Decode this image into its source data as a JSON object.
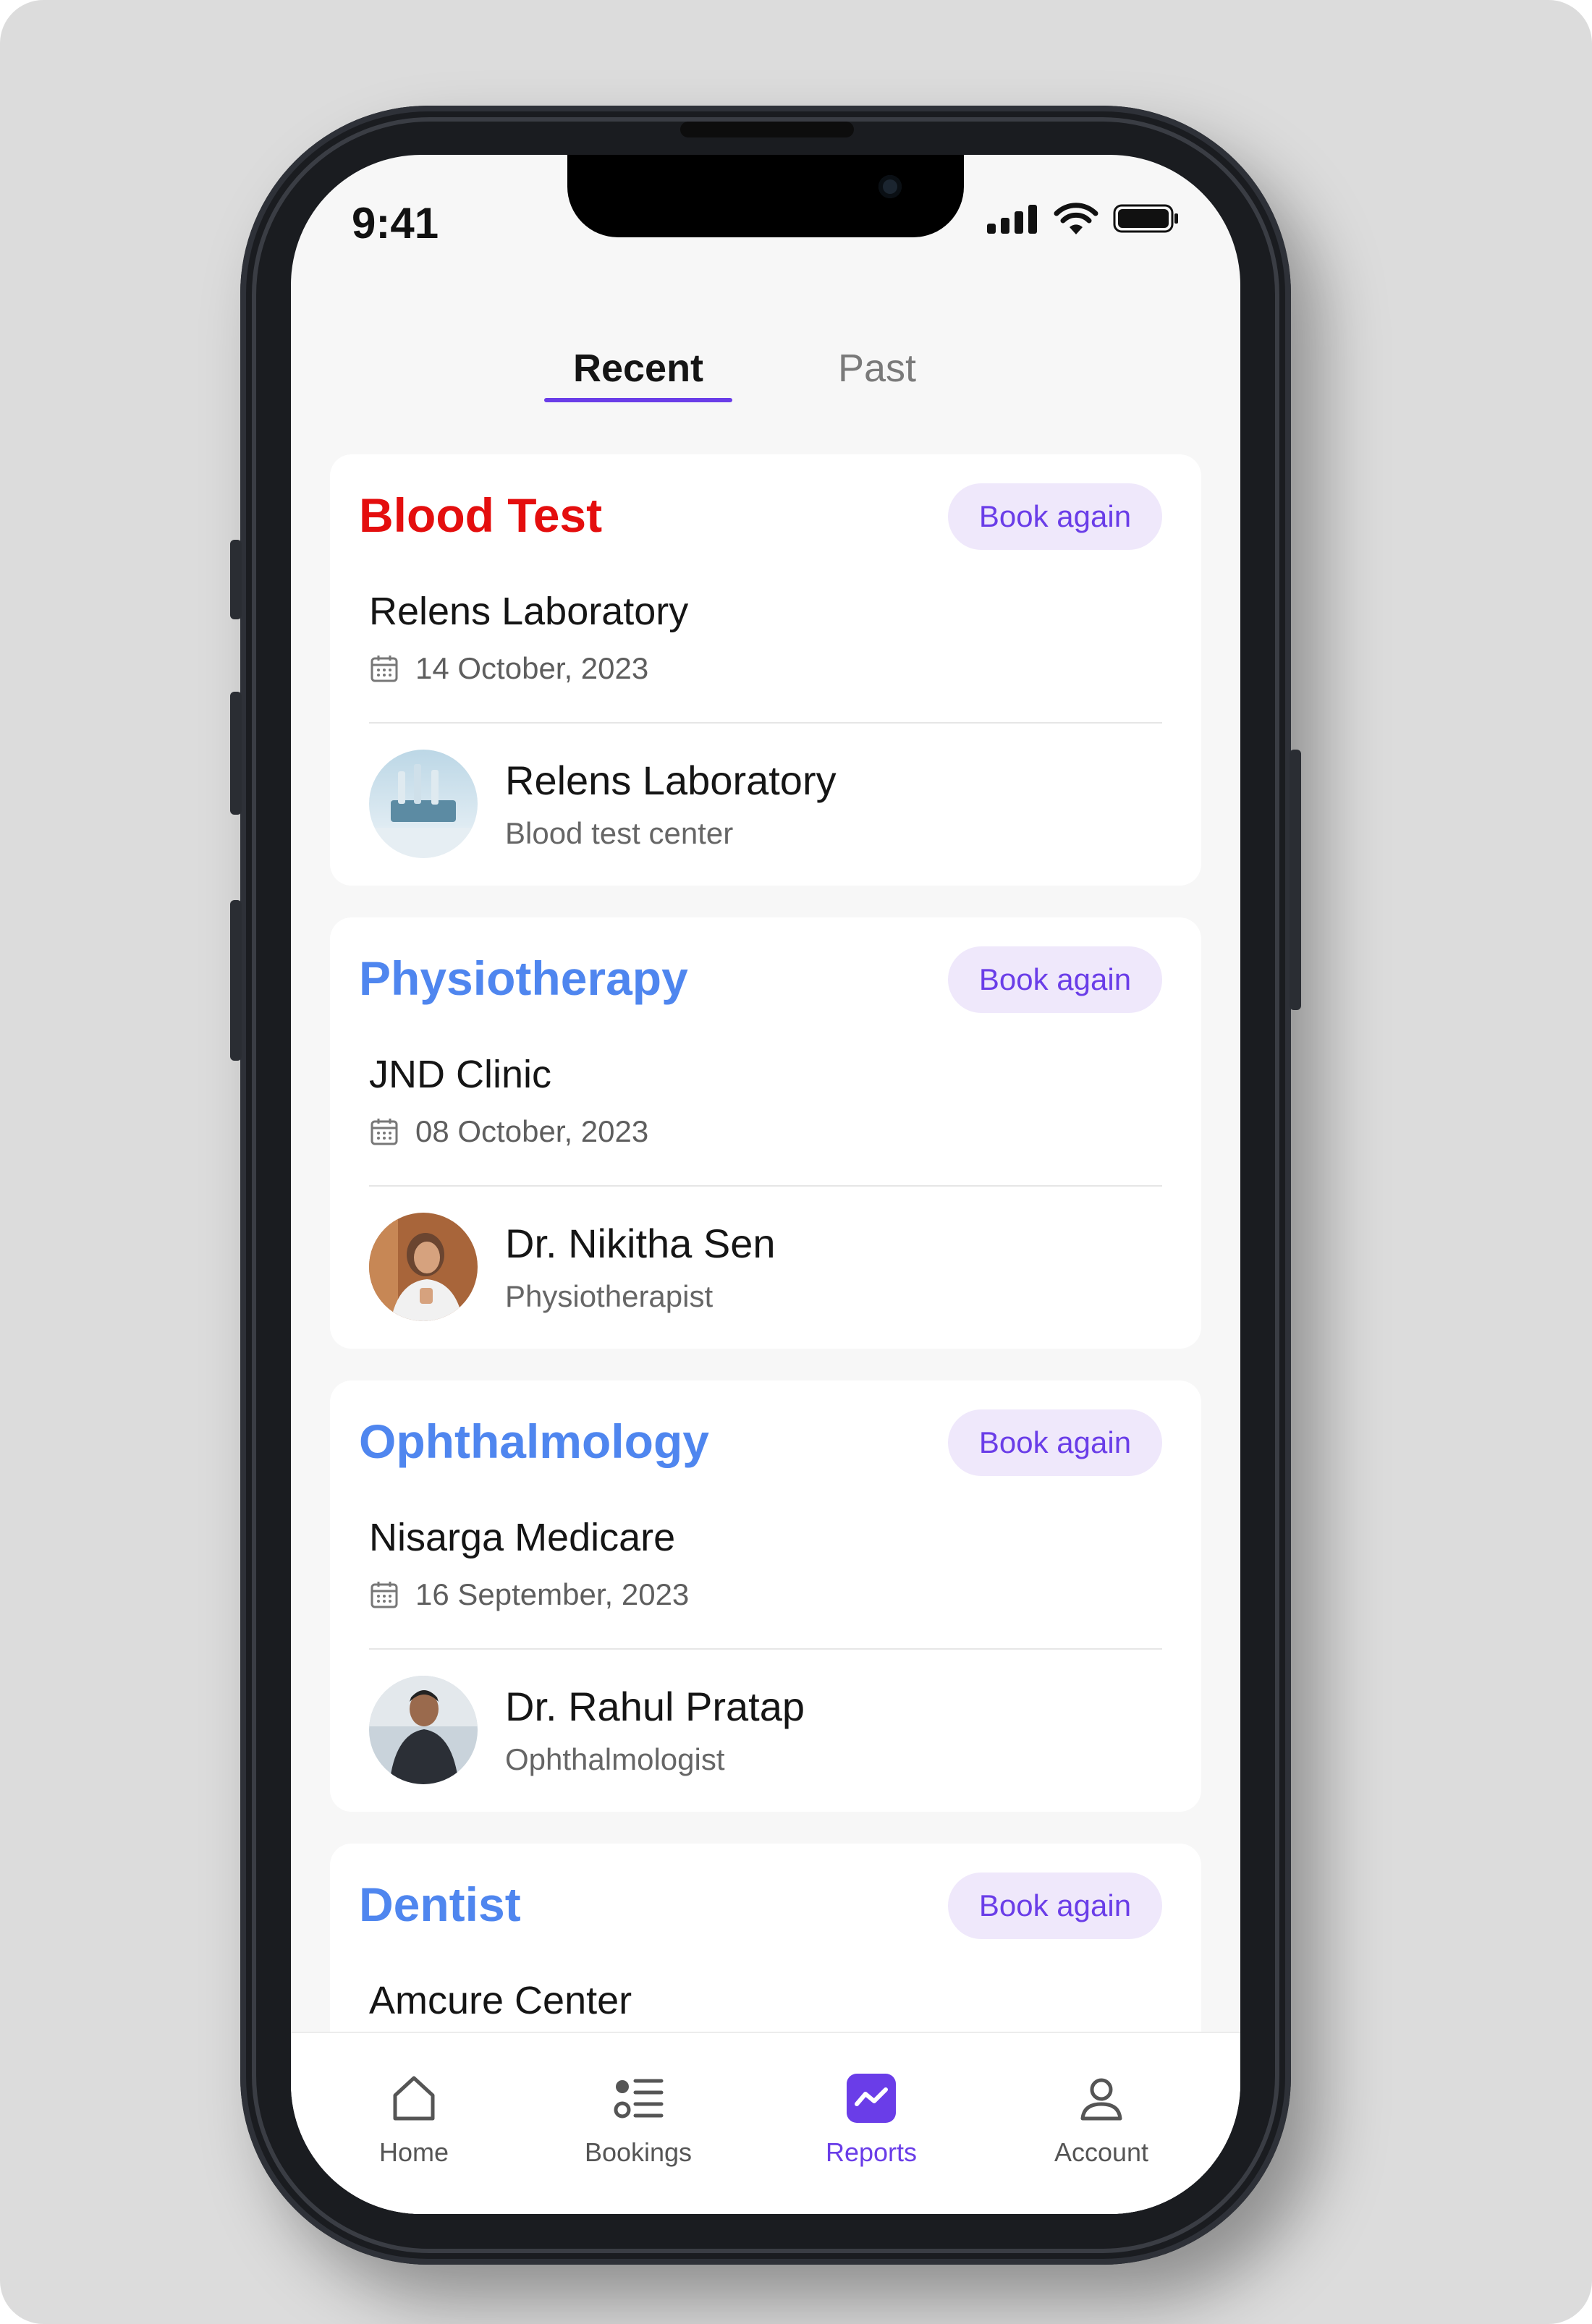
{
  "status_bar": {
    "time": "9:41"
  },
  "tabs": [
    {
      "label": "Recent",
      "active": true
    },
    {
      "label": "Past",
      "active": false
    }
  ],
  "cards": [
    {
      "category": "Blood Test",
      "category_color": "#e40e0e",
      "button_label": "Book again",
      "facility": "Relens Laboratory",
      "date": "14 October, 2023",
      "person_name": "Relens Laboratory",
      "person_role": "Blood test center"
    },
    {
      "category": "Physiotherapy",
      "category_color": "#4f86ef",
      "button_label": "Book again",
      "facility": "JND Clinic",
      "date": "08 October, 2023",
      "person_name": "Dr. Nikitha Sen",
      "person_role": "Physiotherapist"
    },
    {
      "category": "Ophthalmology",
      "category_color": "#4f86ef",
      "button_label": "Book again",
      "facility": "Nisarga Medicare",
      "date": "16 September, 2023",
      "person_name": "Dr. Rahul Pratap",
      "person_role": "Ophthalmologist"
    },
    {
      "category": "Dentist",
      "category_color": "#4f86ef",
      "button_label": "Book again",
      "facility": "Amcure Center"
    }
  ],
  "bottom_nav": [
    {
      "label": "Home",
      "icon": "home-icon",
      "active": false
    },
    {
      "label": "Bookings",
      "icon": "list-icon",
      "active": false
    },
    {
      "label": "Reports",
      "icon": "reports-icon",
      "active": true
    },
    {
      "label": "Account",
      "icon": "user-icon",
      "active": false
    }
  ],
  "colors": {
    "accent": "#6a3de8",
    "accent_soft": "#efe8fb",
    "danger": "#e40e0e",
    "link_blue": "#4f86ef"
  }
}
